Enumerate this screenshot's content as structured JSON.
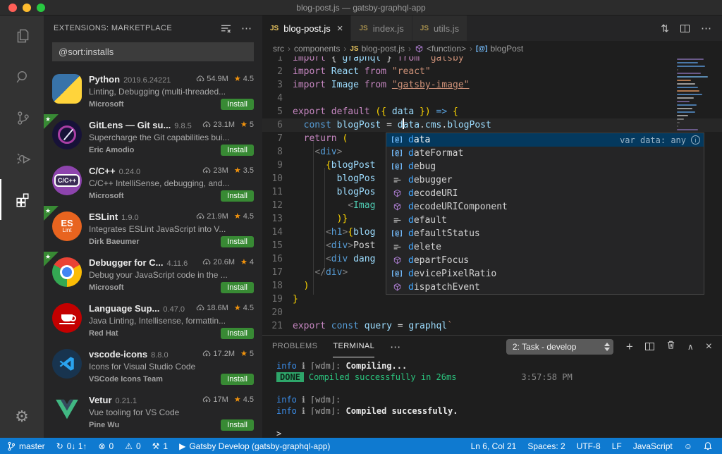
{
  "window": {
    "title": "blog-post.js — gatsby-graphql-app"
  },
  "colors": {
    "statusbar_blue": "#0f7ad0",
    "install_green": "#388a34",
    "star_orange": "#f2930d",
    "done_green": "#2ea66a",
    "terminal_green": "#2bc47e",
    "info_blue": "#3b8eea",
    "suggest_selected": "#04395e",
    "editor_bg": "#1e1e1e",
    "sidebar_bg": "#252526",
    "activitybar_bg": "#333333"
  },
  "activity_bar": {
    "items": [
      {
        "icon": "explorer-icon",
        "active": false
      },
      {
        "icon": "search-icon",
        "active": false
      },
      {
        "icon": "source-control-icon",
        "active": false
      },
      {
        "icon": "debug-icon",
        "active": false
      },
      {
        "icon": "extensions-icon",
        "active": true
      }
    ],
    "settings_icon": "⚙"
  },
  "sidebar": {
    "header": {
      "title": "EXTENSIONS: MARKETPLACE",
      "more": "⋯"
    },
    "search": {
      "value": "@sort:installs"
    },
    "extensions": [
      {
        "name": "Python",
        "version": "2019.6.24221",
        "downloads": "54.9M",
        "rating": "4.5",
        "desc": "Linting, Debugging (multi-threaded...",
        "author": "Microsoft",
        "action": "Install",
        "badge": false,
        "logo": "python"
      },
      {
        "name": "GitLens — Git su...",
        "version": "9.8.5",
        "downloads": "23.1M",
        "rating": "5",
        "desc": "Supercharge the Git capabilities bui...",
        "author": "Eric Amodio",
        "action": "Install",
        "badge": true,
        "logo": "gitlens"
      },
      {
        "name": "C/C++",
        "version": "0.24.0",
        "downloads": "23M",
        "rating": "3.5",
        "desc": "C/C++ IntelliSense, debugging, and...",
        "author": "Microsoft",
        "action": "Install",
        "badge": false,
        "logo": "cpp"
      },
      {
        "name": "ESLint",
        "version": "1.9.0",
        "downloads": "21.9M",
        "rating": "4.5",
        "desc": "Integrates ESLint JavaScript into V...",
        "author": "Dirk Baeumer",
        "action": "Install",
        "badge": true,
        "logo": "eslint"
      },
      {
        "name": "Debugger for C...",
        "version": "4.11.6",
        "downloads": "20.6M",
        "rating": "4",
        "desc": "Debug your JavaScript code in the ...",
        "author": "Microsoft",
        "action": "Install",
        "badge": true,
        "logo": "chrome"
      },
      {
        "name": "Language Sup...",
        "version": "0.47.0",
        "downloads": "18.6M",
        "rating": "4.5",
        "desc": "Java Linting, Intellisense, formattin...",
        "author": "Red Hat",
        "action": "Install",
        "badge": false,
        "logo": "redhat"
      },
      {
        "name": "vscode-icons",
        "version": "8.8.0",
        "downloads": "17.2M",
        "rating": "5",
        "desc": "Icons for Visual Studio Code",
        "author": "VSCode Icons Team",
        "action": "Install",
        "badge": false,
        "logo": "vsicons"
      },
      {
        "name": "Vetur",
        "version": "0.21.1",
        "downloads": "17M",
        "rating": "4.5",
        "desc": "Vue tooling for VS Code",
        "author": "Pine Wu",
        "action": "Install",
        "badge": false,
        "logo": "vue"
      }
    ]
  },
  "editor": {
    "tabs": [
      {
        "label": "blog-post.js",
        "icon": "JS",
        "active": true,
        "close": "×"
      },
      {
        "label": "index.js",
        "icon": "JS",
        "active": false
      },
      {
        "label": "utils.js",
        "icon": "JS",
        "active": false
      }
    ],
    "breadcrumbs": [
      {
        "label": "src"
      },
      {
        "label": "components"
      },
      {
        "label": "blog-post.js",
        "icon": "js"
      },
      {
        "label": "<function>",
        "icon": "cube"
      },
      {
        "label": "blogPost",
        "icon": "var"
      }
    ],
    "code_lines": [
      {
        "n": "1",
        "tokens": [
          [
            "import ",
            "kw"
          ],
          [
            "{ ",
            "p"
          ],
          [
            "graphql",
            "id"
          ],
          [
            " } ",
            "p"
          ],
          [
            "from ",
            "kw"
          ],
          [
            "\"gatsby\"",
            "str"
          ]
        ]
      },
      {
        "n": "2",
        "tokens": [
          [
            "import ",
            "kw"
          ],
          [
            "React",
            "id"
          ],
          [
            " ",
            "p"
          ],
          [
            "from ",
            "kw"
          ],
          [
            "\"react\"",
            "str"
          ]
        ]
      },
      {
        "n": "3",
        "tokens": [
          [
            "import ",
            "kw"
          ],
          [
            "Image",
            "id"
          ],
          [
            " ",
            "p"
          ],
          [
            "from ",
            "kw"
          ],
          [
            "\"gatsby-image\"",
            "strlink"
          ]
        ]
      },
      {
        "n": "4",
        "tokens": []
      },
      {
        "n": "5",
        "tokens": [
          [
            "export ",
            "kw"
          ],
          [
            "default ",
            "kw"
          ],
          [
            "({ ",
            "gold"
          ],
          [
            "data",
            "id"
          ],
          [
            " })",
            "gold"
          ],
          [
            " ",
            "p"
          ],
          [
            "=>",
            "kw2"
          ],
          [
            " {",
            "gold"
          ]
        ]
      },
      {
        "n": "6",
        "active": true,
        "tokens": [
          [
            "  ",
            "p"
          ],
          [
            "const ",
            "kw2"
          ],
          [
            "blogPost",
            "id"
          ],
          [
            " = ",
            "p"
          ],
          [
            "d",
            "id"
          ],
          [
            "|",
            "cursor"
          ],
          [
            "ata",
            "id"
          ],
          [
            ".",
            "p"
          ],
          [
            "cms",
            "id"
          ],
          [
            ".",
            "p"
          ],
          [
            "blogPost",
            "id"
          ]
        ]
      },
      {
        "n": "7",
        "tokens": [
          [
            "  ",
            "p"
          ],
          [
            "return",
            "kw"
          ],
          [
            " (",
            "gold"
          ]
        ]
      },
      {
        "n": "8",
        "tokens": [
          [
            "    ",
            "p"
          ],
          [
            "<",
            "ab"
          ],
          [
            "div",
            "tag"
          ],
          [
            ">",
            "ab"
          ]
        ]
      },
      {
        "n": "9",
        "tokens": [
          [
            "      ",
            "p"
          ],
          [
            "{",
            "gold"
          ],
          [
            "blogPost",
            "id"
          ]
        ]
      },
      {
        "n": "10",
        "tokens": [
          [
            "        ",
            "p"
          ],
          [
            "blogPos",
            "id"
          ]
        ]
      },
      {
        "n": "11",
        "tokens": [
          [
            "        ",
            "p"
          ],
          [
            "blogPos",
            "id"
          ]
        ]
      },
      {
        "n": "12",
        "tokens": [
          [
            "          ",
            "p"
          ],
          [
            "<",
            "ab"
          ],
          [
            "Imag",
            "comp"
          ]
        ]
      },
      {
        "n": "13",
        "tokens": [
          [
            "        ",
            "p"
          ],
          [
            ")}",
            "gold"
          ]
        ]
      },
      {
        "n": "14",
        "tokens": [
          [
            "      ",
            "p"
          ],
          [
            "<",
            "ab"
          ],
          [
            "h1",
            "tag"
          ],
          [
            ">",
            "ab"
          ],
          [
            "{",
            "gold"
          ],
          [
            "blog",
            "id"
          ]
        ]
      },
      {
        "n": "15",
        "tokens": [
          [
            "      ",
            "p"
          ],
          [
            "<",
            "ab"
          ],
          [
            "div",
            "tag"
          ],
          [
            ">",
            "ab"
          ],
          [
            "Post",
            "p"
          ]
        ]
      },
      {
        "n": "16",
        "tokens": [
          [
            "      ",
            "p"
          ],
          [
            "<",
            "ab"
          ],
          [
            "div",
            "tag"
          ],
          [
            " dang",
            "attr"
          ]
        ]
      },
      {
        "n": "17",
        "tokens": [
          [
            "    ",
            "p"
          ],
          [
            "</",
            "ab"
          ],
          [
            "div",
            "tag"
          ],
          [
            ">",
            "ab"
          ]
        ]
      },
      {
        "n": "18",
        "tokens": [
          [
            "  ",
            "p"
          ],
          [
            ")",
            "gold"
          ]
        ]
      },
      {
        "n": "19",
        "tokens": [
          [
            "}",
            "gold"
          ]
        ]
      },
      {
        "n": "20",
        "tokens": []
      },
      {
        "n": "21",
        "tokens": [
          [
            "export ",
            "kw"
          ],
          [
            "const ",
            "kw2"
          ],
          [
            "query",
            "id"
          ],
          [
            " = ",
            "p"
          ],
          [
            "graphql",
            "id"
          ],
          [
            "`",
            "str"
          ]
        ]
      }
    ],
    "suggest": {
      "items": [
        {
          "icon": "var",
          "label": "data",
          "selected": true,
          "detail": "var data: any",
          "info_glyph": "i"
        },
        {
          "icon": "var",
          "label": "dateFormat"
        },
        {
          "icon": "var",
          "label": "debug"
        },
        {
          "icon": "keyword",
          "label": "debugger"
        },
        {
          "icon": "method",
          "label": "decodeURI"
        },
        {
          "icon": "method",
          "label": "decodeURIComponent"
        },
        {
          "icon": "keyword",
          "label": "default"
        },
        {
          "icon": "var",
          "label": "defaultStatus"
        },
        {
          "icon": "keyword",
          "label": "delete"
        },
        {
          "icon": "method",
          "label": "departFocus"
        },
        {
          "icon": "var",
          "label": "devicePixelRatio"
        },
        {
          "icon": "method",
          "label": "dispatchEvent"
        }
      ],
      "match_prefix": "d"
    }
  },
  "panel": {
    "tabs": [
      {
        "label": "PROBLEMS",
        "active": false
      },
      {
        "label": "TERMINAL",
        "active": true
      }
    ],
    "more": "⋯",
    "task_select": "2: Task - develop",
    "terminal_lines": [
      {
        "tokens": [
          [
            "info",
            "info"
          ],
          [
            " ℹ ",
            "dim"
          ],
          [
            "⌈wdm⌋",
            "dim"
          ],
          [
            ": ",
            "dim"
          ],
          [
            "Compiling...",
            "bold"
          ]
        ]
      },
      {
        "tokens": [
          [
            "DONE",
            "badge"
          ],
          [
            "Compiled successfully in 26ms",
            "green"
          ],
          [
            "3:57:58 PM",
            "time"
          ]
        ]
      },
      {
        "tokens": []
      },
      {
        "tokens": [
          [
            "info",
            "info"
          ],
          [
            " ℹ ",
            "dim"
          ],
          [
            "⌈wdm⌋",
            "dim"
          ],
          [
            ":",
            "dim"
          ]
        ]
      },
      {
        "tokens": [
          [
            "info",
            "info"
          ],
          [
            " ℹ ",
            "dim"
          ],
          [
            "⌈wdm⌋",
            "dim"
          ],
          [
            ": ",
            "dim"
          ],
          [
            "Compiled successfully.",
            "bold"
          ]
        ]
      },
      {
        "tokens": []
      },
      {
        "tokens": [
          [
            ">",
            "plain"
          ]
        ]
      }
    ]
  },
  "status_bar": {
    "left": [
      {
        "icon": "git-branch",
        "label": "master"
      },
      {
        "icon": "sync",
        "label": "0↓ 1↑"
      },
      {
        "icon": "error",
        "label": "0"
      },
      {
        "icon": "warning",
        "label": "0"
      },
      {
        "icon": "tools",
        "label": "1"
      },
      {
        "icon": "play",
        "label": "Gatsby Develop (gatsby-graphql-app)"
      }
    ],
    "right": [
      {
        "label": "Ln 6, Col 21"
      },
      {
        "label": "Spaces: 2"
      },
      {
        "label": "UTF-8"
      },
      {
        "label": "LF"
      },
      {
        "label": "JavaScript"
      },
      {
        "icon": "smiley"
      },
      {
        "icon": "bell"
      }
    ]
  }
}
